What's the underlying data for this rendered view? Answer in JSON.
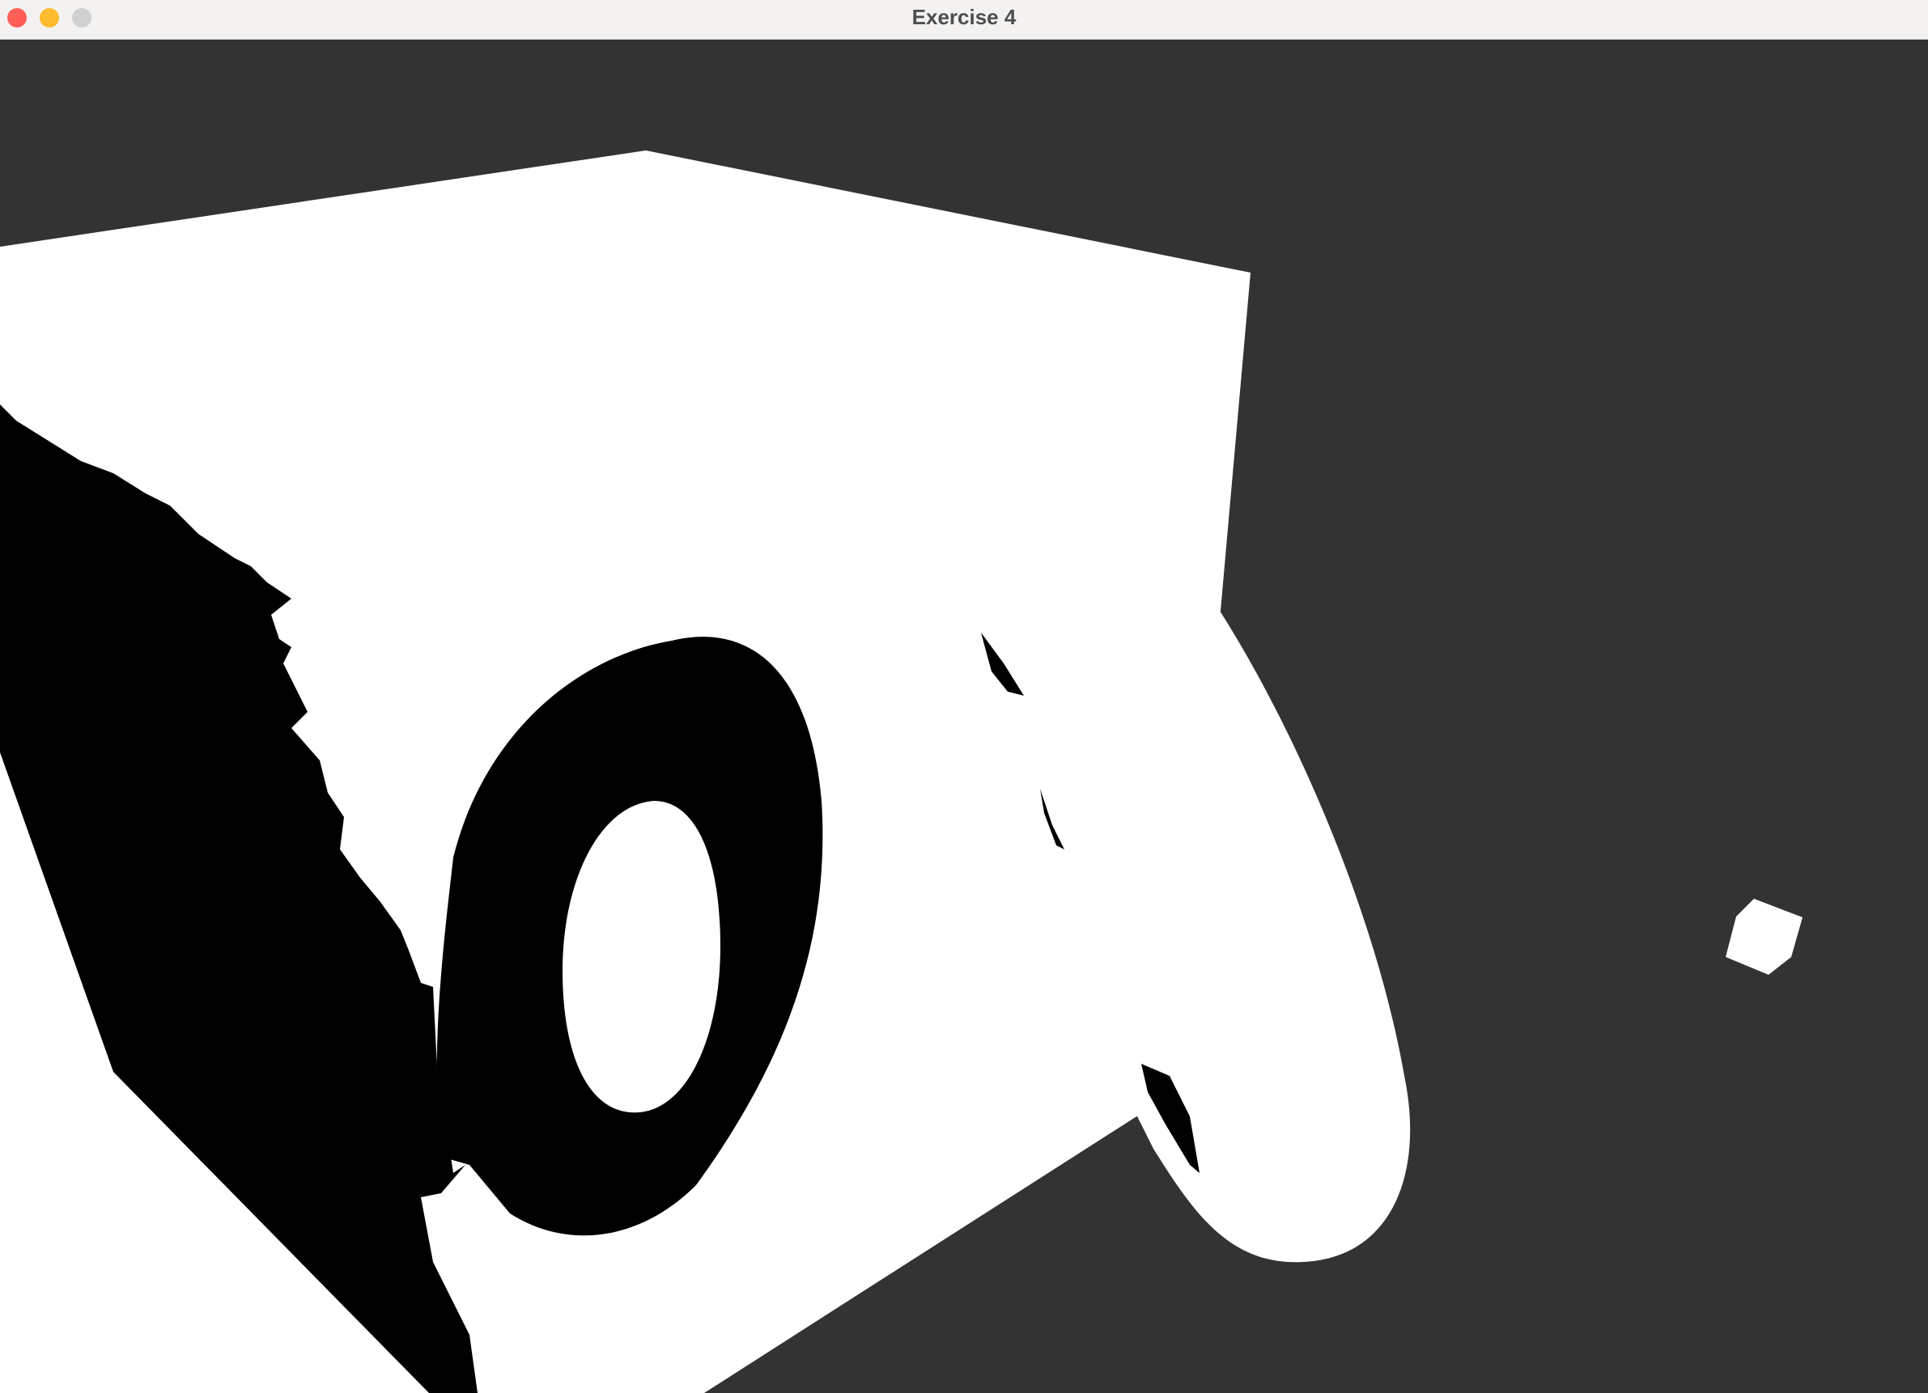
{
  "window": {
    "title": "Exercise 4",
    "controls": {
      "close": {
        "icon": "close-icon",
        "color": "#ff5f57"
      },
      "minimize": {
        "icon": "minimize-icon",
        "color": "#febc2e"
      },
      "zoom": {
        "icon": "zoom-icon",
        "color": "#d0d0d0"
      }
    }
  },
  "scene": {
    "background_color": "#333333",
    "lit_color": "#ffffff",
    "shadow_color": "#000000",
    "objects": [
      "large-cube",
      "torus-shadow",
      "curved-shadow-blob",
      "small-light-cube"
    ]
  }
}
